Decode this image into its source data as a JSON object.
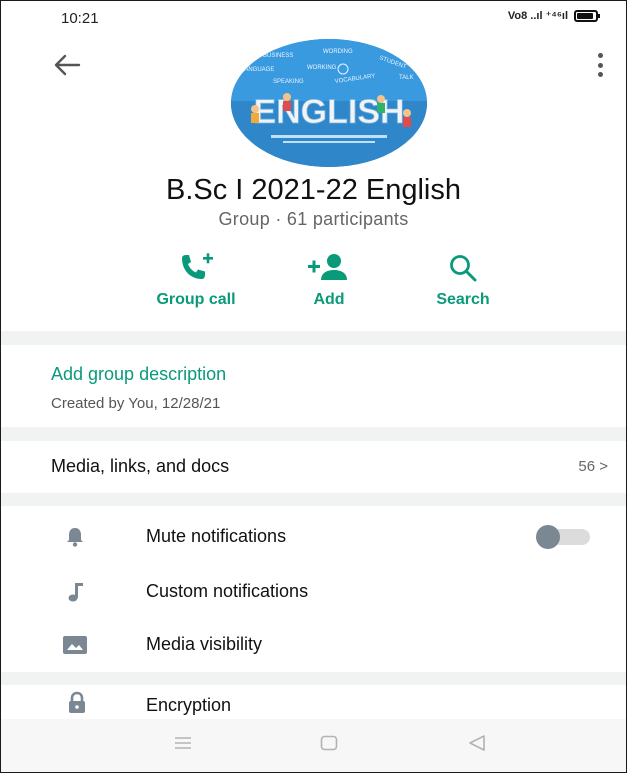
{
  "status_bar": {
    "time": "10:21",
    "indicators": "Vo8 ..ıl ⁺⁴⁶ıl",
    "battery_icon": "battery-icon"
  },
  "header": {
    "back_icon": "arrow-left-icon",
    "menu_icon": "more-vert-icon",
    "group_name": "B.Sc I 2021-22 English",
    "subtitle": "Group · 61 participants",
    "avatar_image": {
      "title_text": "ENGLISH",
      "words": [
        "BUSINESS",
        "WORDING",
        "STUDENT",
        "LANGUAGE",
        "WORKING",
        "SPEAKING",
        "VOCABULARY",
        "TALK"
      ]
    }
  },
  "actions": [
    {
      "label": "Group call",
      "icon": "add-call-icon"
    },
    {
      "label": "Add",
      "icon": "add-person-icon"
    },
    {
      "label": "Search",
      "icon": "search-icon"
    }
  ],
  "description": {
    "add_label": "Add group description",
    "created": "Created by You, 12/28/21"
  },
  "media": {
    "label": "Media, links, and docs",
    "count": "56 >"
  },
  "settings": [
    {
      "label": "Mute notifications",
      "icon": "bell-icon",
      "toggle": false
    },
    {
      "label": "Custom notifications",
      "icon": "music-note-icon"
    },
    {
      "label": "Media visibility",
      "icon": "image-icon"
    }
  ],
  "encryption": {
    "label": "Encryption",
    "icon": "lock-icon"
  },
  "navbar": {
    "buttons": [
      "menu-nav-icon",
      "home-nav-icon",
      "back-nav-icon"
    ]
  },
  "colors": {
    "accent": "#0a9a7a",
    "section_gap": "#f1f2f2",
    "icon_grey": "#7b8793"
  }
}
